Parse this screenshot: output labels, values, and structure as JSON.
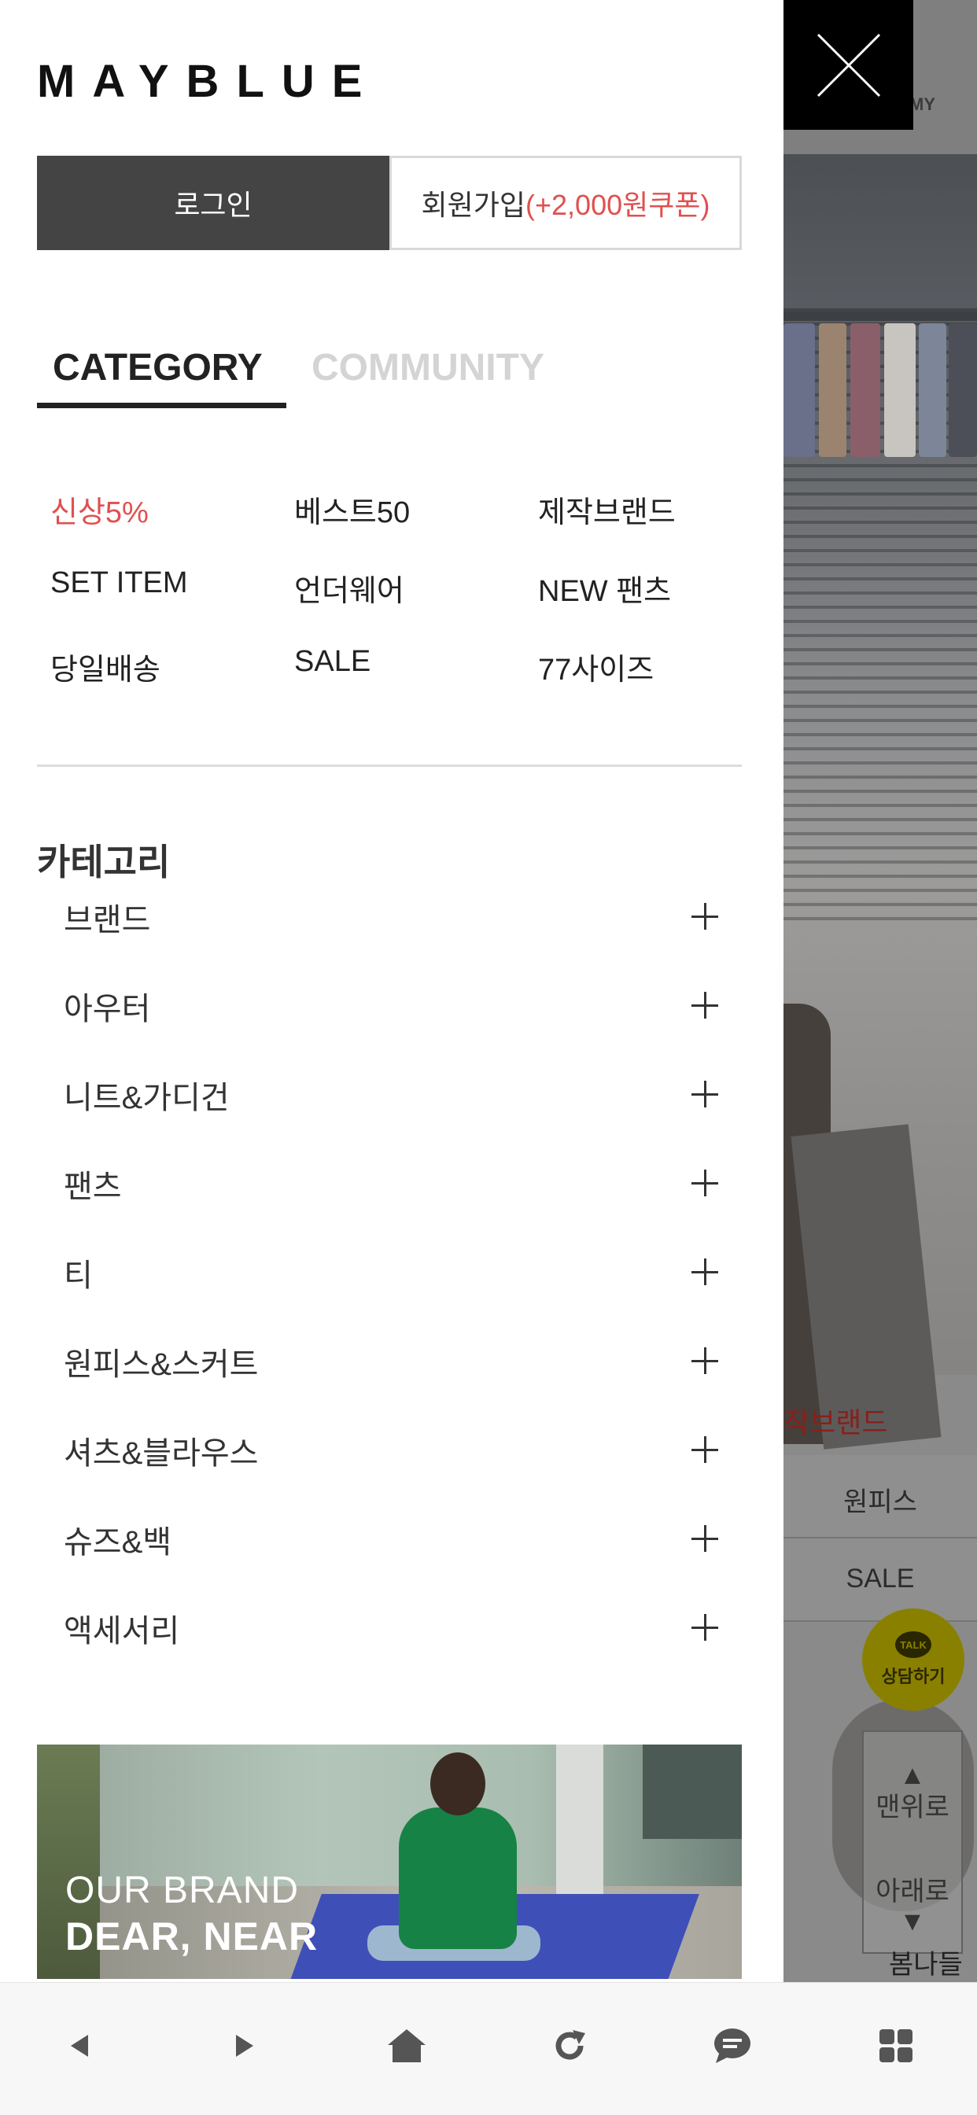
{
  "drawer": {
    "logo": "MAYBLUE",
    "login_label": "로그인",
    "join_label": "회원가입",
    "join_coupon": "(+2,000원쿠폰)",
    "tabs": [
      "CATEGORY",
      "COMMUNITY"
    ],
    "active_tab": "CATEGORY",
    "quick_links": [
      {
        "label": "신상5%",
        "color": "#e0504f"
      },
      {
        "label": "베스트50"
      },
      {
        "label": "제작브랜드"
      },
      {
        "label": "SET ITEM"
      },
      {
        "label": "언더웨어"
      },
      {
        "label": "NEW 팬츠"
      },
      {
        "label": "당일배송"
      },
      {
        "label": "SALE"
      },
      {
        "label": "77사이즈"
      }
    ],
    "category_heading": "카테고리",
    "categories": [
      "브랜드",
      "아우터",
      "니트&가디건",
      "팬츠",
      "티",
      "원피스&스커트",
      "셔츠&블라우스",
      "슈즈&백",
      "액세서리"
    ],
    "banner": {
      "line1": "OUR BRAND",
      "line2": "DEAR, NEAR"
    }
  },
  "background_page": {
    "my_label": "MY",
    "brand_text": "작브랜드",
    "band1": "원피스",
    "band2": "SALE",
    "talk_badge": "TALK",
    "talk_label": "상담하기",
    "scroll_top": "맨위로",
    "scroll_down": "아래로",
    "bottom_text": "봄나들이"
  },
  "colors": {
    "accent_red": "#e0504f",
    "login_bg": "#444444",
    "inactive_tab": "#d4d4d4"
  },
  "bottom_bar": {
    "icons": [
      "back-icon",
      "forward-icon",
      "home-icon",
      "refresh-icon",
      "chat-icon",
      "grid-menu-icon"
    ]
  }
}
